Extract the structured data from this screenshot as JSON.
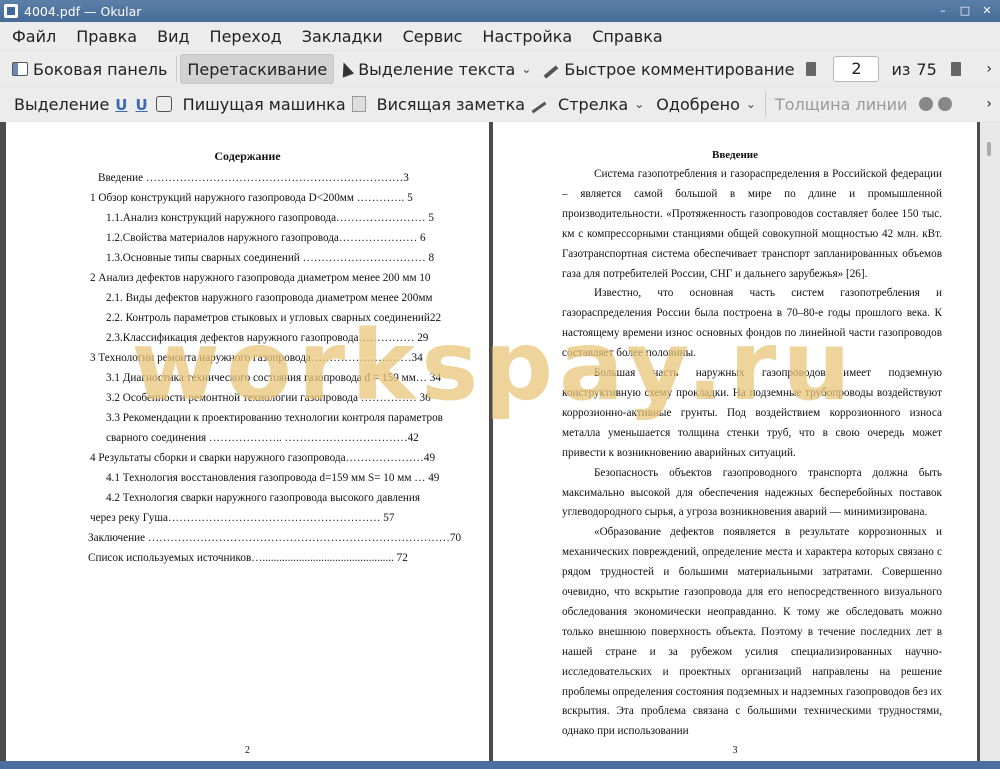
{
  "window": {
    "title": "4004.pdf — Okular"
  },
  "menu": [
    "Файл",
    "Правка",
    "Вид",
    "Переход",
    "Закладки",
    "Сервис",
    "Настройка",
    "Справка"
  ],
  "toolbar1": {
    "sidebar": "Боковая панель",
    "drag": "Перетаскивание",
    "text_select": "Выделение текста",
    "quick_comment": "Быстрое комментирование",
    "page_current": "2",
    "page_of": "из",
    "page_total": "75"
  },
  "toolbar2": {
    "select": "Выделение",
    "typewriter": "Пишущая машинка",
    "sticky_note": "Висящая заметка",
    "arrow": "Стрелка",
    "approved": "Одобрено",
    "line_width": "Толщина линии"
  },
  "left_page": {
    "title": "Содержание",
    "lines": [
      "Введение ……………………………………………………………3",
      "1   Обзор конструкций наружного газопровода D<200мм  ………….  5",
      "1.1.Анализ конструкций наружного газопровода……………………  5",
      "1.2.Свойства материалов наружного газопровода…………………   6",
      "1.3.Основные типы сварных соединений  ……………………………  8",
      "2   Анализ дефектов наружного газопровода диаметром менее 200 мм  10",
      "2.1. Виды дефектов наружного газопровода диаметром менее 200мм",
      "2.2. Контроль параметров стыковых и угловых сварных соединений22",
      "2.3.Классификация дефектов наружного газопровода……………   29",
      "3   Технологии ремонта наружного газопровода………………………34",
      "3.1 Диагностика технического состояния газопровода d = 159 мм…  34",
      "3.2 Особенности ремонтной технологии газопровода ……………   36",
      "3.3 Рекомендации к проектированию технологии контроля параметров",
      "сварного соединения ……………….. ……………………………42",
      "4   Результаты сборки и сварки наружного газопровода…………………49",
      "4.1 Технология восстановления газопровода d=159 мм  S= 10 мм   … 49",
      "4.2   Технология сварки наружного газопровода   высокого давления",
      "через реку Гуша…………………………………………………   57",
      "Заключение ………………………………………………………………………70",
      "Список  используемых  источников…...............................................    72"
    ],
    "page_number": "2"
  },
  "right_page": {
    "title": "Введение",
    "paragraphs": [
      "Система газопотребления и газораспределения в Российской федерации – является самой большой в мире по длине и промышленной производительности. «Протяженность газопроводов составляет более 150 тыс. км с компрессорными станциями общей совокупной мощностью 42 млн. кВт. Газотранспортная система обеспечивает транспорт запланированных объемов газа для потребителей России, СНГ и дальнего зарубежья» [26].",
      "Известно, что основная часть систем газопотребления и газораспределения России была построена в 70–80-е годы прошлого века. К настоящему времени износ основных фондов по линейной части газопроводов составляет более половины.",
      "Большая часть наружных газопроводов имеет подземную конструктивную схему прокладки. На подземные трубопроводы воздействуют коррозионно-активные грунты. Под воздействием коррозионного износа металла уменьшается толщина стенки труб, что в свою очередь может привести к возникновению аварийных ситуаций.",
      "Безопасность объектов газопроводного транспорта должна быть максимально высокой для обеспечения надежных бесперебойных поставок углеводородного сырья, а угроза возникновения аварий — минимизирована.",
      "«Образование дефектов появляется в результате коррозионных и механических повреждений, определение места и характера которых связано с рядом трудностей и большими материальными затратами. Совершенно очевидно, что вскрытие газопровода для его непосредственного визуального обследования экономически неоправданно. К тому же обследовать можно только внешнюю поверхность объекта. Поэтому в течение последних лет в нашей стране и за рубежом усилия специализированных научно-исследовательских и проектных организаций направлены на решение проблемы определения состояния подземных и надземных газопроводов без их вскрытия. Эта проблема связана с большими техническими трудностями, однако при использовании"
    ],
    "page_number": "3"
  },
  "watermark": "workspay.ru"
}
